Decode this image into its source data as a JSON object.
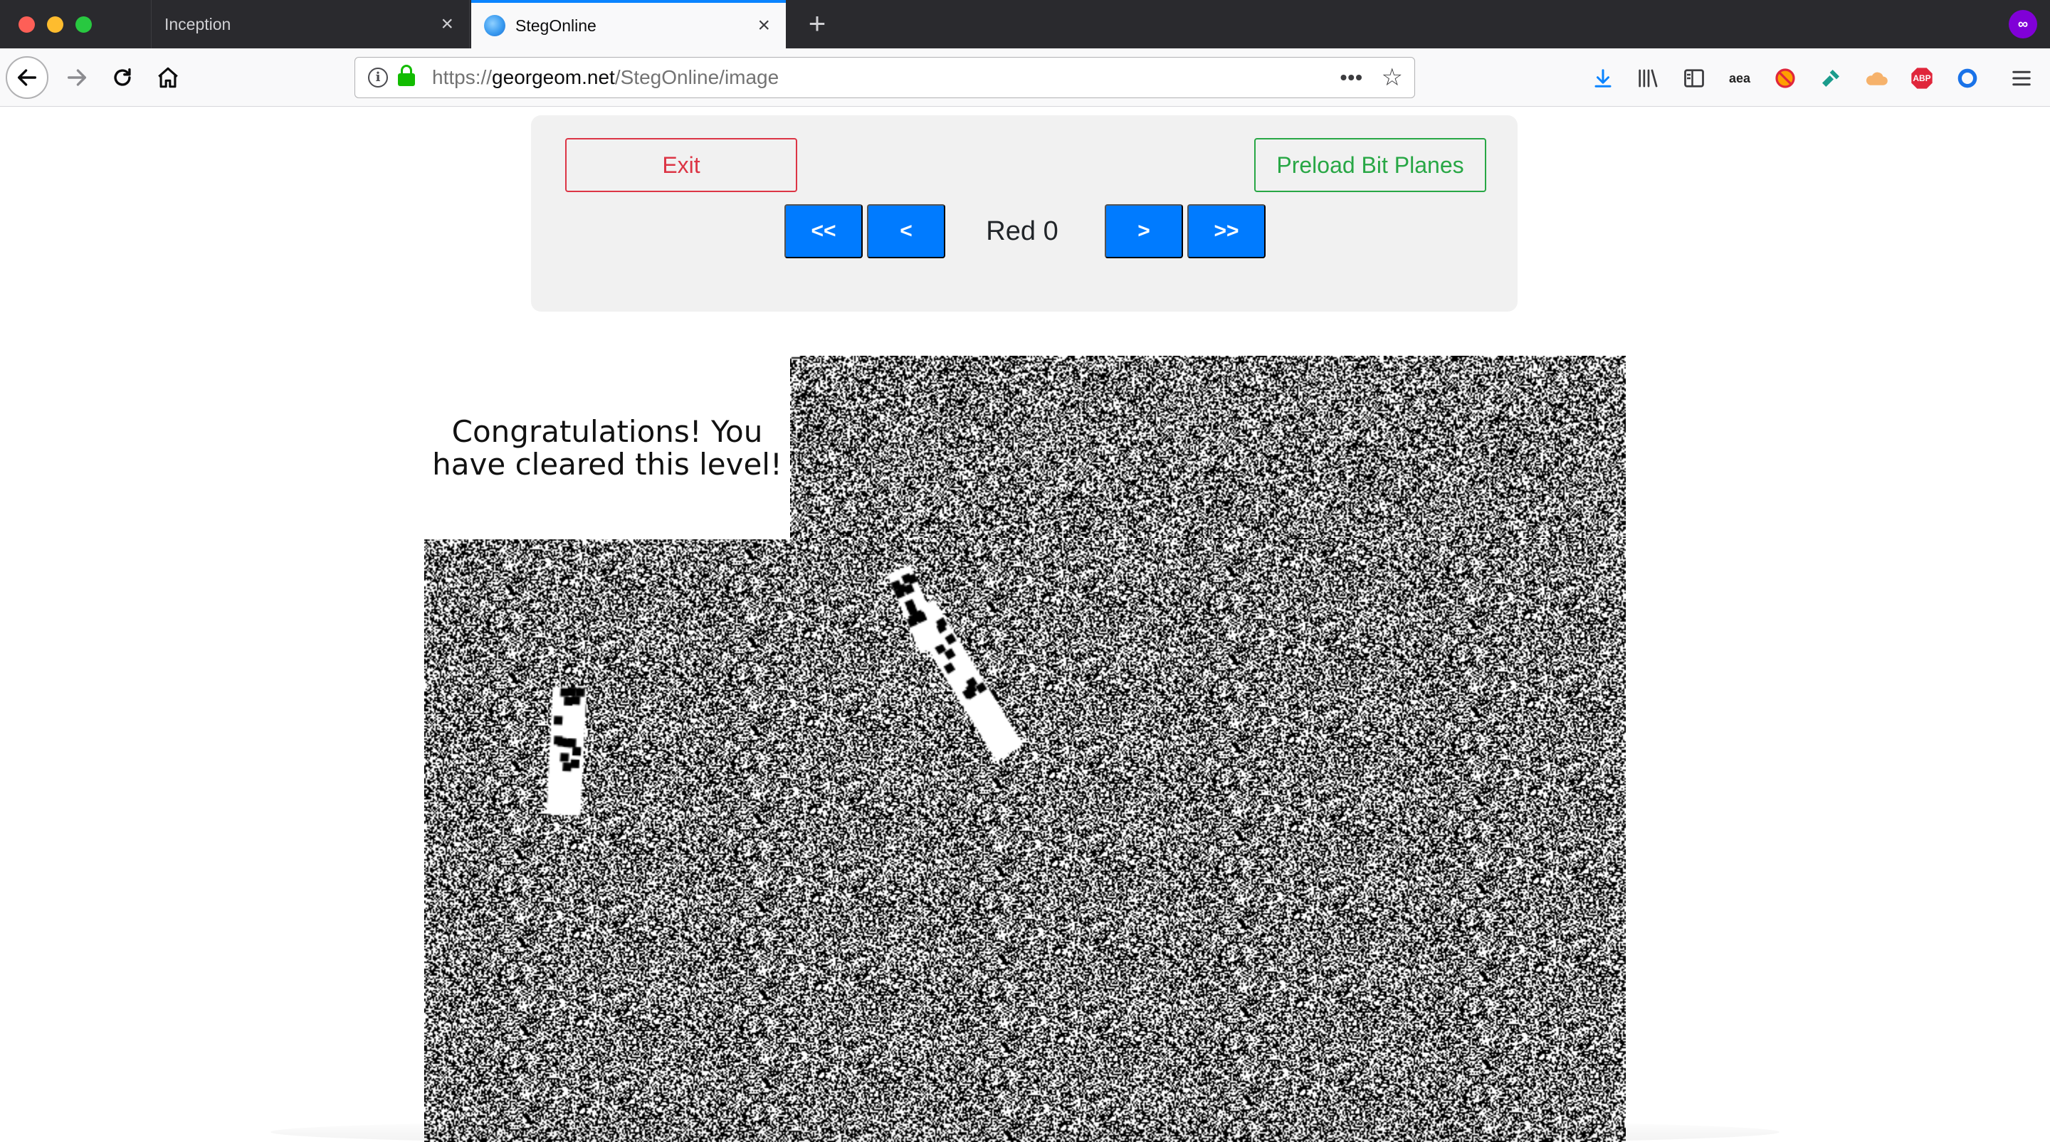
{
  "browser": {
    "tabs": [
      {
        "title": "Inception",
        "active": false
      },
      {
        "title": "StegOnline",
        "active": true
      }
    ],
    "url": {
      "prefix": "https://",
      "domain": "georgeom.net",
      "path": "/StegOnline/image"
    },
    "toolbar_icons": [
      "downloads-icon",
      "library-icon",
      "sidebar-icon",
      "amazon-assistant-icon",
      "blocker-icon",
      "wrench-icon",
      "cloud-icon",
      "adblock-plus-icon",
      "ring-icon",
      "menu-icon"
    ],
    "abp_label": "ABP",
    "aea_label": "aea"
  },
  "controls": {
    "exit_label": "Exit",
    "preload_label": "Preload Bit Planes",
    "first_label": "<<",
    "prev_label": "<",
    "next_label": ">",
    "last_label": ">>",
    "plane_label": "Red 0"
  },
  "image": {
    "message_line1": "Congratulations! You",
    "message_line2": "have cleared this level!"
  },
  "colors": {
    "danger": "#dc3545",
    "success": "#28a745",
    "primary": "#007bff",
    "tab_accent": "#0a84ff"
  }
}
